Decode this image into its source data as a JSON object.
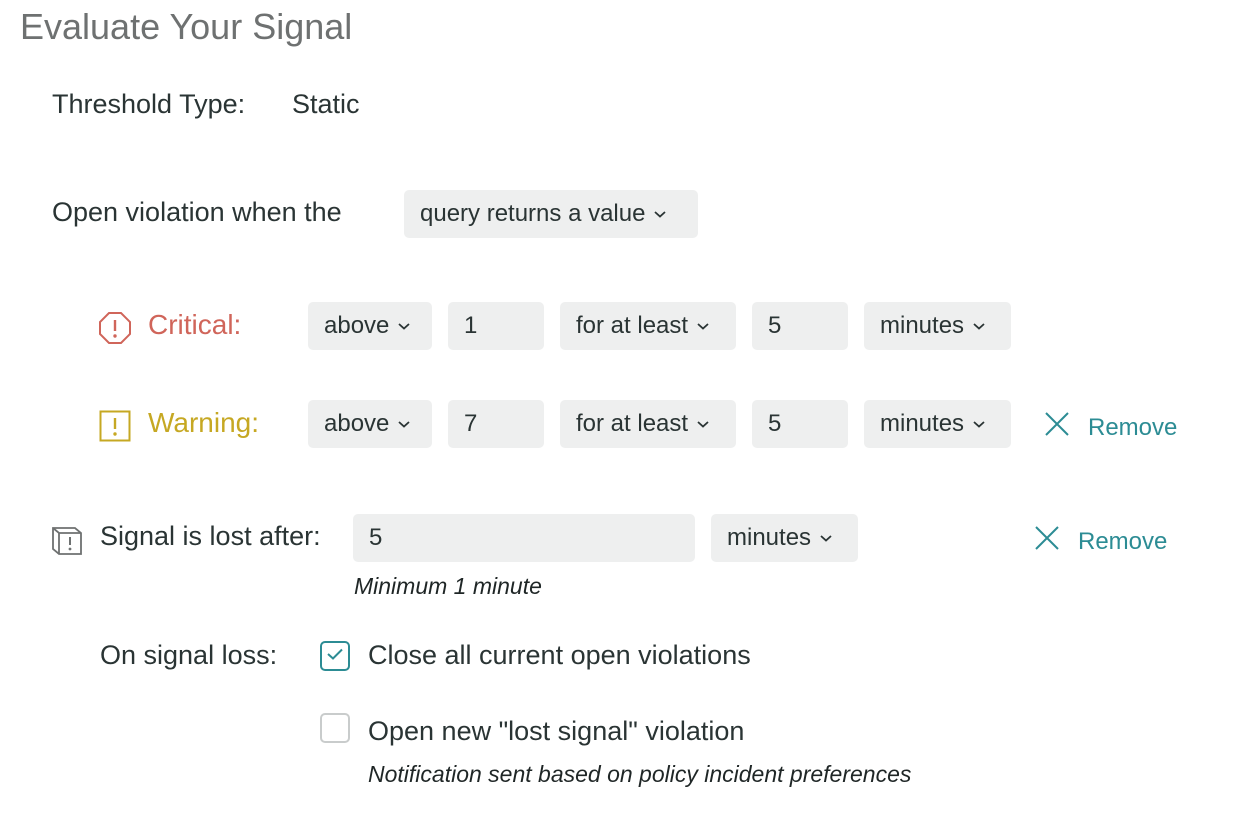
{
  "page": {
    "title": "Evaluate Your Signal"
  },
  "threshold": {
    "label": "Threshold Type:",
    "value": "Static"
  },
  "open_violation": {
    "label": "Open violation when the",
    "selected": "query returns a value"
  },
  "critical": {
    "label": "Critical:",
    "operator": "above",
    "threshold": "1",
    "occurrence": "for at least",
    "duration": "5",
    "unit": "minutes",
    "color": "#d0655a",
    "icon": "octagon-alert-icon"
  },
  "warning": {
    "label": "Warning:",
    "operator": "above",
    "threshold": "7",
    "occurrence": "for at least",
    "duration": "5",
    "unit": "minutes",
    "remove_label": "Remove",
    "color": "#c6a823",
    "icon": "square-alert-icon"
  },
  "signal_lost": {
    "label": "Signal is lost after:",
    "value": "5",
    "unit": "minutes",
    "hint": "Minimum 1 minute",
    "remove_label": "Remove",
    "icon": "signal-lost-box-icon"
  },
  "signal_loss": {
    "label": "On signal loss:",
    "options": [
      {
        "label": "Close all current open violations",
        "checked": true
      },
      {
        "label": "Open new \"lost signal\" violation",
        "checked": false,
        "note": "Notification sent based on policy incident preferences"
      }
    ]
  },
  "colors": {
    "accent": "#2c8c94",
    "field_bg": "#eeefef",
    "title": "#6e7171"
  }
}
